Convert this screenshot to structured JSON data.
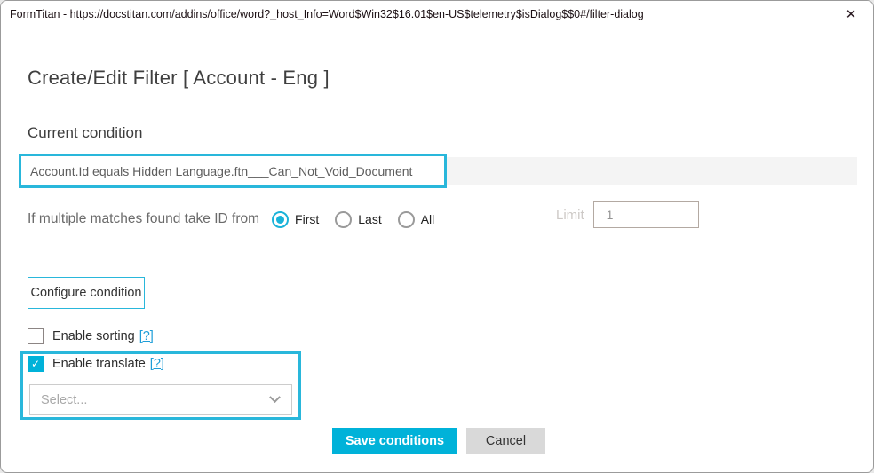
{
  "window": {
    "title": "FormTitan - https://docstitan.com/addins/office/word?_host_Info=Word$Win32$16.01$en-US$telemetry$isDialog$$0#/filter-dialog"
  },
  "icons": {
    "close": "✕",
    "check": "✓"
  },
  "dialog": {
    "heading": "Create/Edit Filter [ Account - Eng ]",
    "section_title": "Current condition",
    "condition_text": "Account.Id equals Hidden Language.ftn___Can_Not_Void_Document",
    "match_label": "If multiple matches found take ID from",
    "radios": [
      {
        "label": "First",
        "selected": true
      },
      {
        "label": "Last",
        "selected": false
      },
      {
        "label": "All",
        "selected": false
      }
    ],
    "limit": {
      "label": "Limit",
      "value": "1"
    },
    "configure_button": "Configure condition",
    "sorting": {
      "label": "Enable sorting",
      "help_label": "[?]",
      "checked": false
    },
    "translate": {
      "label": "Enable translate",
      "help_label": "[?]",
      "checked": true
    },
    "select": {
      "placeholder": "Select..."
    },
    "save_button": "Save conditions",
    "cancel_button": "Cancel"
  },
  "colors": {
    "accent": "#00b2d9",
    "highlight_border": "#29b7db",
    "link": "#1e9ed8",
    "condition_bar_bg": "#f4f4f4",
    "cancel_bg": "#d9d9d9",
    "disabled_text": "#cdc9c6",
    "window_border": "#9b9b9b"
  }
}
